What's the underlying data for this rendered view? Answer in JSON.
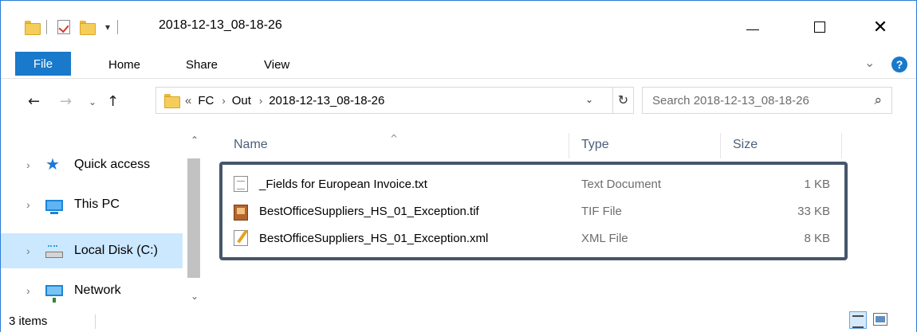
{
  "window": {
    "title": "2018-12-13_08-18-26",
    "qat_dropdown": "▾",
    "minimize_icon": "minimize-icon",
    "maximize_icon": "maximize-icon",
    "close_glyph": "✕"
  },
  "ribbon": {
    "tabs": [
      {
        "label": "File"
      },
      {
        "label": "Home"
      },
      {
        "label": "Share"
      },
      {
        "label": "View"
      }
    ],
    "expand_glyph": "⌄",
    "help_glyph": "?"
  },
  "nav": {
    "back_glyph": "←",
    "forward_glyph": "→",
    "recent_glyph": "⌄",
    "up_glyph": "↑",
    "breadcrumb_overflow": "«",
    "breadcrumbs": [
      "FC",
      "Out",
      "2018-12-13_08-18-26"
    ],
    "separator": "›",
    "address_dropdown": "⌄",
    "refresh_glyph": "↻",
    "search_placeholder": "Search 2018-12-13_08-18-26",
    "search_glyph": "⌕"
  },
  "navpane": {
    "items": [
      {
        "label": "Quick access",
        "icon": "quick-access-star-icon"
      },
      {
        "label": "This PC",
        "icon": "this-pc-icon"
      },
      {
        "label": "Local Disk (C:)",
        "icon": "local-disk-icon"
      },
      {
        "label": "Network",
        "icon": "network-icon"
      }
    ],
    "expander_glyph": "›",
    "scroll_up": "⌃",
    "scroll_down": "⌄"
  },
  "filelist": {
    "sort_glyph": "^",
    "columns": {
      "name": "Name",
      "type": "Type",
      "size": "Size"
    },
    "files": [
      {
        "name": "_Fields for European Invoice.txt",
        "type": "Text Document",
        "size": "1 KB",
        "icon": "text-file-icon"
      },
      {
        "name": "BestOfficeSuppliers_HS_01_Exception.tif",
        "type": "TIF File",
        "size": "33 KB",
        "icon": "tif-image-icon"
      },
      {
        "name": "BestOfficeSuppliers_HS_01_Exception.xml",
        "type": "XML File",
        "size": "8 KB",
        "icon": "xml-file-icon"
      }
    ],
    "highlight_color": "#46566a"
  },
  "status": {
    "item_count": "3 items"
  },
  "colors": {
    "accent": "#1979ca",
    "selection": "#cce8ff",
    "border": "#2b7bd8"
  }
}
